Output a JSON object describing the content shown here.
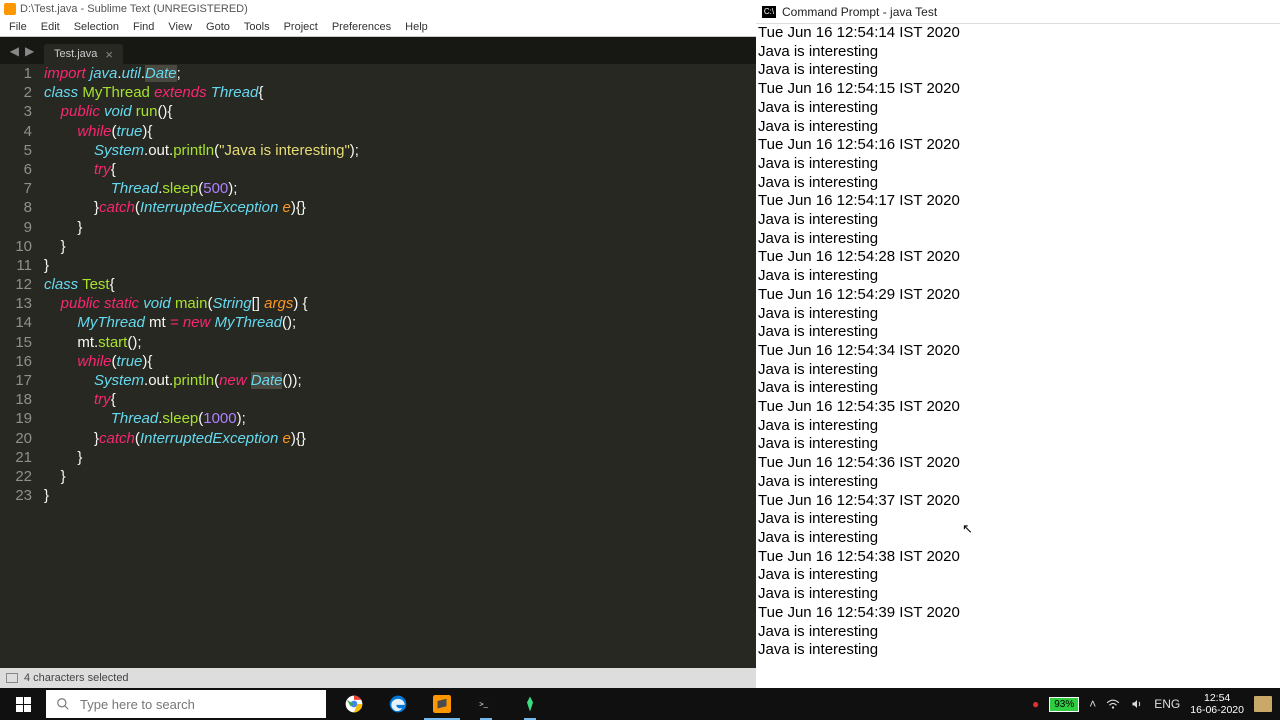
{
  "sublime": {
    "title": "D:\\Test.java - Sublime Text (UNREGISTERED)",
    "menus": [
      "File",
      "Edit",
      "Selection",
      "Find",
      "View",
      "Goto",
      "Tools",
      "Project",
      "Preferences",
      "Help"
    ],
    "tab": "Test.java",
    "status": "4 characters selected",
    "code_rows": [
      [
        [
          "kw",
          "import"
        ],
        [
          "pl",
          " "
        ],
        [
          "typ",
          "java"
        ],
        [
          "pl",
          "."
        ],
        [
          "typ",
          "util"
        ],
        [
          "pl",
          "."
        ],
        [
          "sel typ",
          "Date"
        ],
        [
          "pl",
          ";"
        ]
      ],
      [
        [
          "kw2",
          "class"
        ],
        [
          "pl",
          " "
        ],
        [
          "fn",
          "MyThread"
        ],
        [
          "pl",
          " "
        ],
        [
          "kw",
          "extends"
        ],
        [
          "pl",
          " "
        ],
        [
          "typ",
          "Thread"
        ],
        [
          "pl",
          "{"
        ]
      ],
      [
        [
          "pl",
          "    "
        ],
        [
          "kw",
          "public"
        ],
        [
          "pl",
          " "
        ],
        [
          "kw2",
          "void"
        ],
        [
          "pl",
          " "
        ],
        [
          "fn",
          "run"
        ],
        [
          "pl",
          "(){"
        ]
      ],
      [
        [
          "pl",
          "        "
        ],
        [
          "kw",
          "while"
        ],
        [
          "pl",
          "("
        ],
        [
          "kw2",
          "true"
        ],
        [
          "pl",
          "){"
        ]
      ],
      [
        [
          "pl",
          "            "
        ],
        [
          "typ",
          "System"
        ],
        [
          "pl",
          ".out."
        ],
        [
          "fn",
          "println"
        ],
        [
          "pl",
          "("
        ],
        [
          "str",
          "\"Java is interesting\""
        ],
        [
          "pl",
          ");"
        ]
      ],
      [
        [
          "pl",
          "            "
        ],
        [
          "kw",
          "try"
        ],
        [
          "pl",
          "{"
        ]
      ],
      [
        [
          "pl",
          "                "
        ],
        [
          "typ",
          "Thread"
        ],
        [
          "pl",
          "."
        ],
        [
          "fn",
          "sleep"
        ],
        [
          "pl",
          "("
        ],
        [
          "num",
          "500"
        ],
        [
          "pl",
          ");"
        ]
      ],
      [
        [
          "pl",
          "            }"
        ],
        [
          "kw",
          "catch"
        ],
        [
          "pl",
          "("
        ],
        [
          "typ",
          "InterruptedException"
        ],
        [
          "pl",
          " "
        ],
        [
          "var",
          "e"
        ],
        [
          "pl",
          "){}"
        ]
      ],
      [
        [
          "pl",
          "        }"
        ]
      ],
      [
        [
          "pl",
          "    }"
        ]
      ],
      [
        [
          "pl",
          "}"
        ]
      ],
      [
        [
          "kw2",
          "class"
        ],
        [
          "pl",
          " "
        ],
        [
          "fn",
          "Test"
        ],
        [
          "pl",
          "{"
        ]
      ],
      [
        [
          "pl",
          "    "
        ],
        [
          "kw",
          "public"
        ],
        [
          "pl",
          " "
        ],
        [
          "kw",
          "static"
        ],
        [
          "pl",
          " "
        ],
        [
          "kw2",
          "void"
        ],
        [
          "pl",
          " "
        ],
        [
          "fn",
          "main"
        ],
        [
          "pl",
          "("
        ],
        [
          "typ",
          "String"
        ],
        [
          "pl",
          "[] "
        ],
        [
          "var",
          "args"
        ],
        [
          "pl",
          ") {"
        ]
      ],
      [
        [
          "pl",
          "        "
        ],
        [
          "typ",
          "MyThread"
        ],
        [
          "pl",
          " mt "
        ],
        [
          "kw",
          "="
        ],
        [
          "pl",
          " "
        ],
        [
          "kw",
          "new"
        ],
        [
          "pl",
          " "
        ],
        [
          "typ",
          "MyThread"
        ],
        [
          "pl",
          "();"
        ]
      ],
      [
        [
          "pl",
          "        mt."
        ],
        [
          "fn",
          "start"
        ],
        [
          "pl",
          "();"
        ]
      ],
      [
        [
          "pl",
          "        "
        ],
        [
          "kw",
          "while"
        ],
        [
          "pl",
          "("
        ],
        [
          "kw2",
          "true"
        ],
        [
          "pl",
          "){"
        ]
      ],
      [
        [
          "pl",
          "            "
        ],
        [
          "typ",
          "System"
        ],
        [
          "pl",
          ".out."
        ],
        [
          "fn",
          "println"
        ],
        [
          "pl",
          "("
        ],
        [
          "kw",
          "new"
        ],
        [
          "pl",
          " "
        ],
        [
          "sel typ",
          "Date"
        ],
        [
          "pl",
          "());"
        ]
      ],
      [
        [
          "pl",
          "            "
        ],
        [
          "kw",
          "try"
        ],
        [
          "pl",
          "{"
        ]
      ],
      [
        [
          "pl",
          "                "
        ],
        [
          "typ",
          "Thread"
        ],
        [
          "pl",
          "."
        ],
        [
          "fn",
          "sleep"
        ],
        [
          "pl",
          "("
        ],
        [
          "num",
          "1000"
        ],
        [
          "pl",
          ");"
        ]
      ],
      [
        [
          "pl",
          "            }"
        ],
        [
          "kw",
          "catch"
        ],
        [
          "pl",
          "("
        ],
        [
          "typ",
          "InterruptedException"
        ],
        [
          "pl",
          " "
        ],
        [
          "var",
          "e"
        ],
        [
          "pl",
          "){}"
        ]
      ],
      [
        [
          "pl",
          "        }"
        ]
      ],
      [
        [
          "pl",
          "    }"
        ]
      ],
      [
        [
          "pl",
          "}"
        ]
      ]
    ]
  },
  "cmd": {
    "title": "Command Prompt - java  Test",
    "lines": [
      "Tue Jun 16 12:54:14 IST 2020",
      "Java is interesting",
      "Java is interesting",
      "Tue Jun 16 12:54:15 IST 2020",
      "Java is interesting",
      "Java is interesting",
      "Tue Jun 16 12:54:16 IST 2020",
      "Java is interesting",
      "Java is interesting",
      "Tue Jun 16 12:54:17 IST 2020",
      "Java is interesting",
      "Java is interesting",
      "Tue Jun 16 12:54:28 IST 2020",
      "Java is interesting",
      "Tue Jun 16 12:54:29 IST 2020",
      "Java is interesting",
      "Java is interesting",
      "Tue Jun 16 12:54:34 IST 2020",
      "Java is interesting",
      "Java is interesting",
      "Tue Jun 16 12:54:35 IST 2020",
      "Java is interesting",
      "Java is interesting",
      "Tue Jun 16 12:54:36 IST 2020",
      "Java is interesting",
      "Tue Jun 16 12:54:37 IST 2020",
      "Java is interesting",
      "Java is interesting",
      "Tue Jun 16 12:54:38 IST 2020",
      "Java is interesting",
      "Java is interesting",
      "Tue Jun 16 12:54:39 IST 2020",
      "Java is interesting",
      "Java is interesting"
    ]
  },
  "taskbar": {
    "search_placeholder": "Type here to search",
    "battery": "93%",
    "lang": "ENG",
    "time": "12:54",
    "date": "16-06-2020"
  }
}
